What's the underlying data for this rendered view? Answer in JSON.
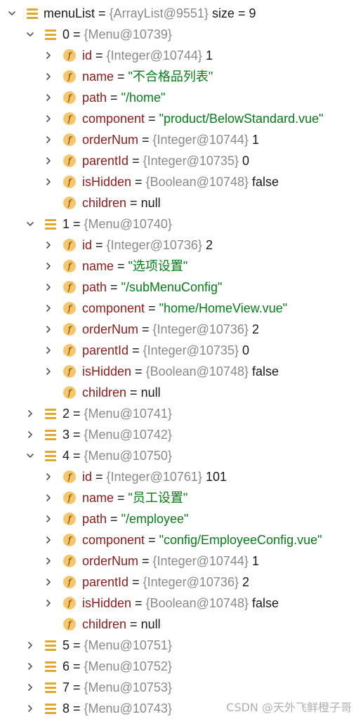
{
  "tree": [
    {
      "depth": 0,
      "chevron": "down",
      "icon": "list",
      "name": "menuList",
      "type": "{ArrayList@9551}",
      "value": "size = 9",
      "vclass": "plain",
      "nameStyle": "plain"
    },
    {
      "depth": 1,
      "chevron": "down",
      "icon": "list",
      "name": "0",
      "type": "{Menu@10739}",
      "value": "",
      "nameStyle": "plain"
    },
    {
      "depth": 2,
      "chevron": "right",
      "icon": "field",
      "name": "id",
      "type": "{Integer@10744}",
      "value": "1",
      "vclass": "plain"
    },
    {
      "depth": 2,
      "chevron": "right",
      "icon": "field",
      "name": "name",
      "type": "",
      "value": "\"不合格品列表\"",
      "vclass": "str"
    },
    {
      "depth": 2,
      "chevron": "right",
      "icon": "field",
      "name": "path",
      "type": "",
      "value": "\"/home\"",
      "vclass": "str"
    },
    {
      "depth": 2,
      "chevron": "right",
      "icon": "field",
      "name": "component",
      "type": "",
      "value": "\"product/BelowStandard.vue\"",
      "vclass": "str"
    },
    {
      "depth": 2,
      "chevron": "right",
      "icon": "field",
      "name": "orderNum",
      "type": "{Integer@10744}",
      "value": "1",
      "vclass": "plain"
    },
    {
      "depth": 2,
      "chevron": "right",
      "icon": "field",
      "name": "parentId",
      "type": "{Integer@10735}",
      "value": "0",
      "vclass": "plain"
    },
    {
      "depth": 2,
      "chevron": "right",
      "icon": "field",
      "name": "isHidden",
      "type": "{Boolean@10748}",
      "value": "false",
      "vclass": "plain"
    },
    {
      "depth": 2,
      "chevron": "none",
      "icon": "field",
      "name": "children",
      "type": "",
      "value": "null",
      "vclass": "plain"
    },
    {
      "depth": 1,
      "chevron": "down",
      "icon": "list",
      "name": "1",
      "type": "{Menu@10740}",
      "value": "",
      "nameStyle": "plain"
    },
    {
      "depth": 2,
      "chevron": "right",
      "icon": "field",
      "name": "id",
      "type": "{Integer@10736}",
      "value": "2",
      "vclass": "plain"
    },
    {
      "depth": 2,
      "chevron": "right",
      "icon": "field",
      "name": "name",
      "type": "",
      "value": "\"选项设置\"",
      "vclass": "str"
    },
    {
      "depth": 2,
      "chevron": "right",
      "icon": "field",
      "name": "path",
      "type": "",
      "value": "\"/subMenuConfig\"",
      "vclass": "str"
    },
    {
      "depth": 2,
      "chevron": "right",
      "icon": "field",
      "name": "component",
      "type": "",
      "value": "\"home/HomeView.vue\"",
      "vclass": "str"
    },
    {
      "depth": 2,
      "chevron": "right",
      "icon": "field",
      "name": "orderNum",
      "type": "{Integer@10736}",
      "value": "2",
      "vclass": "plain"
    },
    {
      "depth": 2,
      "chevron": "right",
      "icon": "field",
      "name": "parentId",
      "type": "{Integer@10735}",
      "value": "0",
      "vclass": "plain"
    },
    {
      "depth": 2,
      "chevron": "right",
      "icon": "field",
      "name": "isHidden",
      "type": "{Boolean@10748}",
      "value": "false",
      "vclass": "plain"
    },
    {
      "depth": 2,
      "chevron": "none",
      "icon": "field",
      "name": "children",
      "type": "",
      "value": "null",
      "vclass": "plain"
    },
    {
      "depth": 1,
      "chevron": "right",
      "icon": "list",
      "name": "2",
      "type": "{Menu@10741}",
      "value": "",
      "nameStyle": "plain"
    },
    {
      "depth": 1,
      "chevron": "right",
      "icon": "list",
      "name": "3",
      "type": "{Menu@10742}",
      "value": "",
      "nameStyle": "plain"
    },
    {
      "depth": 1,
      "chevron": "down",
      "icon": "list",
      "name": "4",
      "type": "{Menu@10750}",
      "value": "",
      "nameStyle": "plain"
    },
    {
      "depth": 2,
      "chevron": "right",
      "icon": "field",
      "name": "id",
      "type": "{Integer@10761}",
      "value": "101",
      "vclass": "plain"
    },
    {
      "depth": 2,
      "chevron": "right",
      "icon": "field",
      "name": "name",
      "type": "",
      "value": "\"员工设置\"",
      "vclass": "str"
    },
    {
      "depth": 2,
      "chevron": "right",
      "icon": "field",
      "name": "path",
      "type": "",
      "value": "\"/employee\"",
      "vclass": "str"
    },
    {
      "depth": 2,
      "chevron": "right",
      "icon": "field",
      "name": "component",
      "type": "",
      "value": "\"config/EmployeeConfig.vue\"",
      "vclass": "str"
    },
    {
      "depth": 2,
      "chevron": "right",
      "icon": "field",
      "name": "orderNum",
      "type": "{Integer@10744}",
      "value": "1",
      "vclass": "plain"
    },
    {
      "depth": 2,
      "chevron": "right",
      "icon": "field",
      "name": "parentId",
      "type": "{Integer@10736}",
      "value": "2",
      "vclass": "plain"
    },
    {
      "depth": 2,
      "chevron": "right",
      "icon": "field",
      "name": "isHidden",
      "type": "{Boolean@10748}",
      "value": "false",
      "vclass": "plain"
    },
    {
      "depth": 2,
      "chevron": "none",
      "icon": "field",
      "name": "children",
      "type": "",
      "value": "null",
      "vclass": "plain"
    },
    {
      "depth": 1,
      "chevron": "right",
      "icon": "list",
      "name": "5",
      "type": "{Menu@10751}",
      "value": "",
      "nameStyle": "plain"
    },
    {
      "depth": 1,
      "chevron": "right",
      "icon": "list",
      "name": "6",
      "type": "{Menu@10752}",
      "value": "",
      "nameStyle": "plain"
    },
    {
      "depth": 1,
      "chevron": "right",
      "icon": "list",
      "name": "7",
      "type": "{Menu@10753}",
      "value": "",
      "nameStyle": "plain"
    },
    {
      "depth": 1,
      "chevron": "right",
      "icon": "list",
      "name": "8",
      "type": "{Menu@10743}",
      "value": "",
      "nameStyle": "plain"
    }
  ],
  "field_icon_glyph": "f",
  "watermark": "CSDN @天外飞鲜橙子哥",
  "colors": {
    "field_name": "#8b1b1b",
    "type_ref": "#8a8a8a",
    "string": "#067d17",
    "list_icon": "#e0a72a",
    "field_icon": "#f7c66b"
  }
}
